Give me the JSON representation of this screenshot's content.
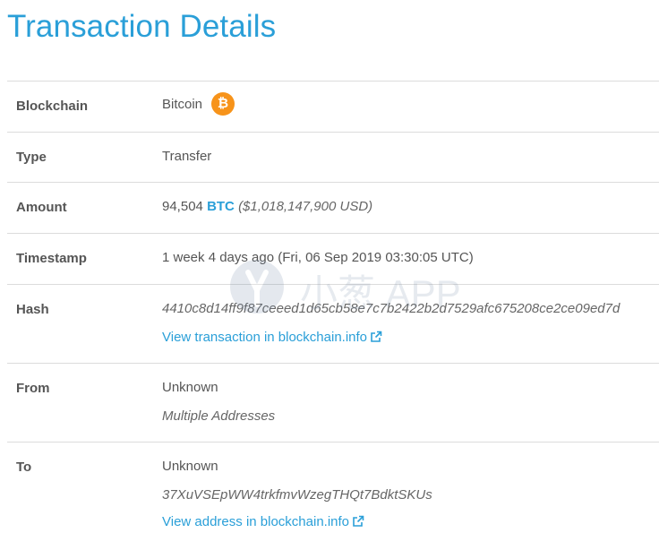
{
  "page": {
    "title": "Transaction Details"
  },
  "rows": {
    "blockchain": {
      "label": "Blockchain",
      "value": "Bitcoin",
      "icon": "bitcoin-icon",
      "icon_glyph": "₿",
      "icon_color": "#f7931a"
    },
    "type": {
      "label": "Type",
      "value": "Transfer"
    },
    "amount": {
      "label": "Amount",
      "number": "94,504",
      "currency": "BTC",
      "usd": "($1,018,147,900 USD)"
    },
    "timestamp": {
      "label": "Timestamp",
      "value": "1 week 4 days ago (Fri, 06 Sep 2019 03:30:05 UTC)"
    },
    "hash": {
      "label": "Hash",
      "value": "4410c8d14ff9f87ceeed1d65cb58e7c7b2422b2d7529afc675208ce2ce09ed7d",
      "link": "View transaction in blockchain.info"
    },
    "from": {
      "label": "From",
      "value": "Unknown",
      "sub": "Multiple Addresses"
    },
    "to": {
      "label": "To",
      "value": "Unknown",
      "address": "37XuVSEpWW4trkfmvWzegTHQt7BdktSKUs",
      "link": "View address in blockchain.info"
    }
  },
  "watermark": {
    "text": "小葱 APP"
  },
  "colors": {
    "accent": "#2a9fd8",
    "bitcoin": "#f7931a",
    "border": "#dcdcdc"
  }
}
